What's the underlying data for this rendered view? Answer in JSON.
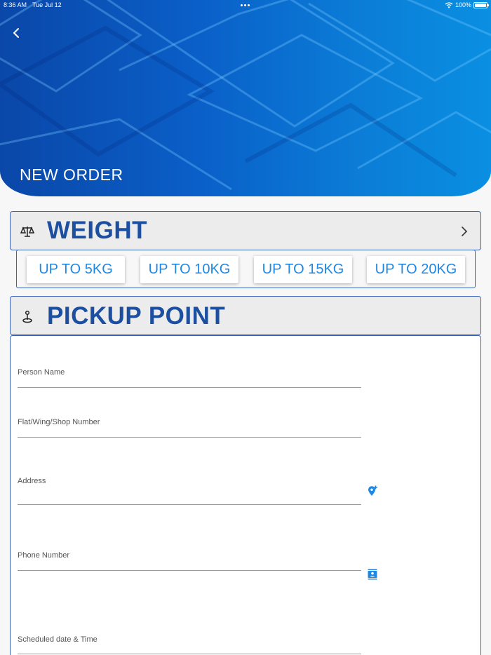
{
  "status": {
    "time": "8:36 AM",
    "date": "Tue Jul 12",
    "battery": "100%"
  },
  "header": {
    "title": "NEW ORDER"
  },
  "weight": {
    "title": "WEIGHT",
    "options": [
      "UP TO 5KG",
      "UP TO 10KG",
      "UP TO 15KG",
      "UP TO 20KG"
    ]
  },
  "pickup": {
    "title": "PICKUP POINT",
    "fields": {
      "person_name": "Person Name",
      "flat": "Flat/Wing/Shop Number",
      "address": "Address",
      "phone": "Phone Number",
      "schedule": "Scheduled date & Time"
    }
  },
  "icons": {
    "back": "chevron-left-icon",
    "weight": "scale-icon",
    "expand": "chevron-right-icon",
    "pickup": "pin-icon",
    "address": "add-location-icon",
    "phone": "contacts-icon"
  },
  "colors": {
    "accent": "#1e88e5",
    "title": "#1d4fa0",
    "header": "#0a5fc8",
    "border": "#3a63b8"
  }
}
